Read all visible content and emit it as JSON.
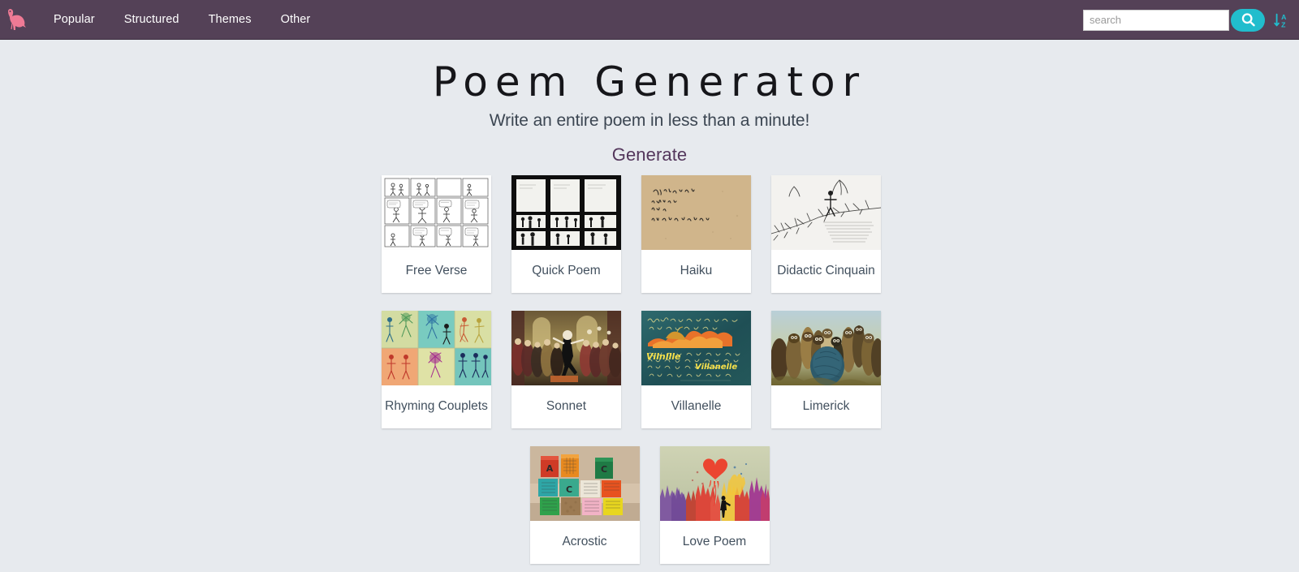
{
  "nav": {
    "logo_icon": "kangaroo-logo-icon",
    "links": [
      {
        "label": "Popular"
      },
      {
        "label": "Structured"
      },
      {
        "label": "Themes"
      },
      {
        "label": "Other"
      }
    ],
    "search": {
      "placeholder": "search",
      "value": "",
      "button_icon": "search-icon"
    },
    "sort": {
      "icon": "sort-alpha-down-icon",
      "label": "↓AZ"
    },
    "colors": {
      "bar": "#544157",
      "accent": "#21bdcd",
      "logo": "#ef7a95"
    }
  },
  "header": {
    "title": "Poem Generator",
    "subtitle": "Write an entire poem in less than a minute!",
    "section": "Generate"
  },
  "grid": {
    "rows": [
      {
        "cards": [
          {
            "label": "Free Verse",
            "thumb": "comic-strip-stick-figures-white"
          },
          {
            "label": "Quick Poem",
            "thumb": "comic-panels-dark"
          },
          {
            "label": "Haiku",
            "thumb": "tan-paper-handwriting"
          },
          {
            "label": "Didactic Cinquain",
            "thumb": "branch-sketch-figure"
          }
        ]
      },
      {
        "cards": [
          {
            "label": "Rhyming Couplets",
            "thumb": "colorful-dancer-panels"
          },
          {
            "label": "Sonnet",
            "thumb": "painting-dancer-crowd"
          },
          {
            "label": "Villanelle",
            "thumb": "teal-chalkboard-sunset-text"
          },
          {
            "label": "Limerick",
            "thumb": "owl-figures-group"
          }
        ]
      },
      {
        "centered": true,
        "cards": [
          {
            "label": "Acrostic",
            "thumb": "alphabet-blocks"
          },
          {
            "label": "Love Poem",
            "thumb": "heart-balloon-silhouette"
          }
        ]
      }
    ]
  }
}
